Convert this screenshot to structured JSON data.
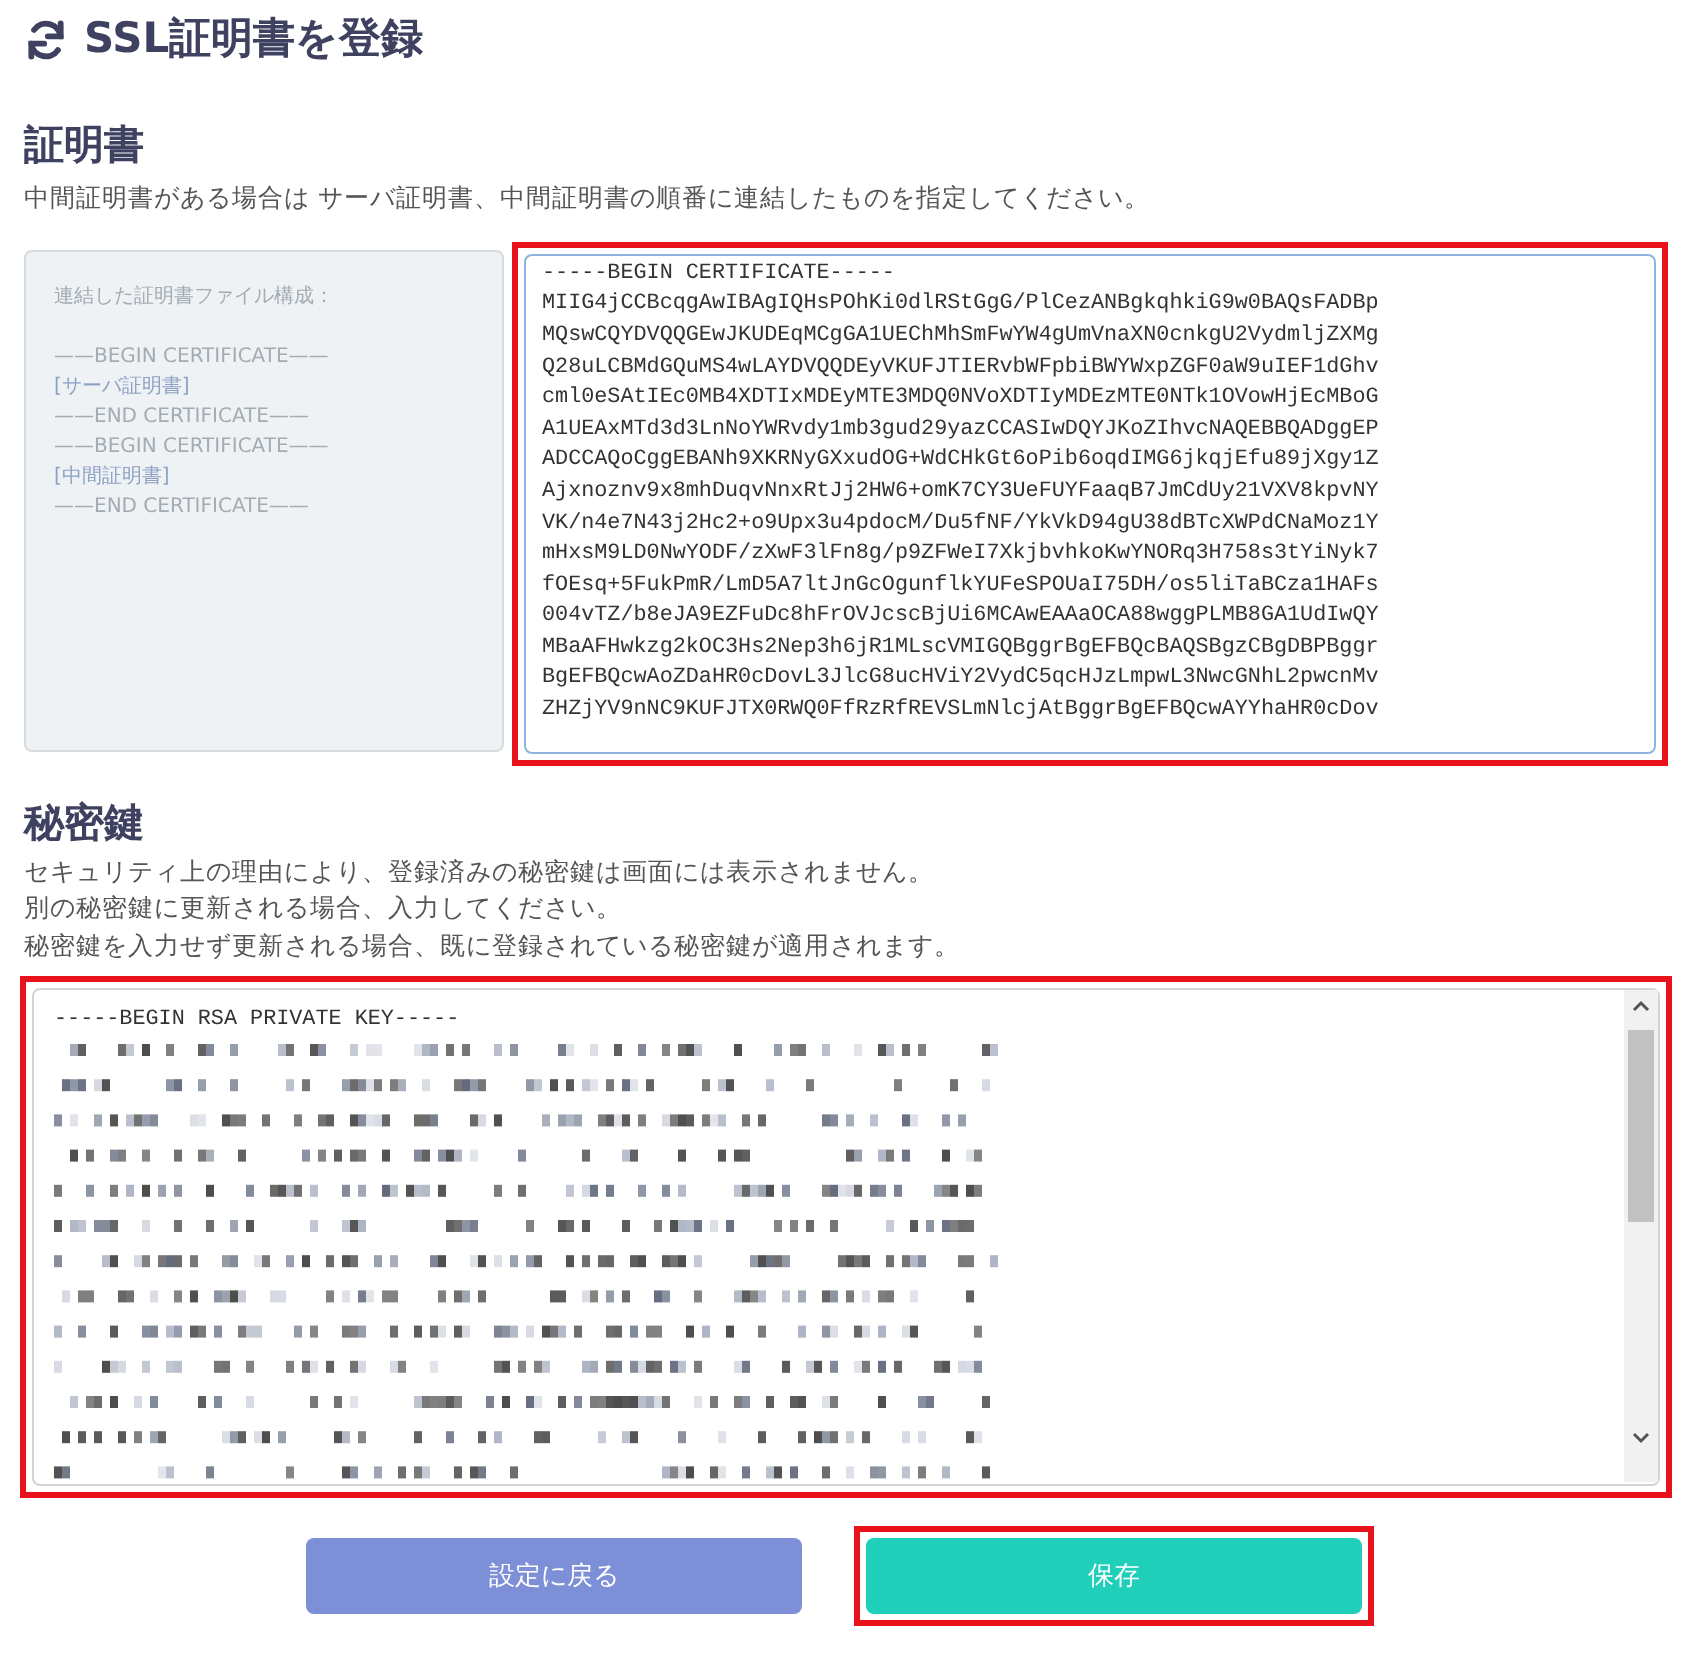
{
  "title": "SSL証明書を登録",
  "certificate": {
    "heading": "証明書",
    "description": "中間証明書がある場合は サーバ証明書、中間証明書の順番に連結したものを指定してください。",
    "format_hint": {
      "caption": "連結した証明書ファイル構成：",
      "lines": [
        {
          "text": "——BEGIN CERTIFICATE——",
          "kind": "boundary"
        },
        {
          "text": "[サーバ証明書]",
          "kind": "slot"
        },
        {
          "text": "——END CERTIFICATE——",
          "kind": "boundary"
        },
        {
          "text": "——BEGIN CERTIFICATE——",
          "kind": "boundary"
        },
        {
          "text": "[中間証明書]",
          "kind": "slot"
        },
        {
          "text": "——END CERTIFICATE——",
          "kind": "boundary"
        }
      ]
    },
    "value": "-----BEGIN CERTIFICATE-----\nMIIG4jCCBcqgAwIBAgIQHsPOhKi0dlRStGgG/PlCezANBgkqhkiG9w0BAQsFADBp\nMQswCQYDVQQGEwJKUDEqMCgGA1UEChMhSmFwYW4gUmVnaXN0cnkgU2VydmljZXMg\nQ28uLCBMdGQuMS4wLAYDVQQDEyVKUFJTIERvbWFpbiBWYWxpZGF0aW9uIEF1dGhv\ncml0eSAtIEc0MB4XDTIxMDEyMTE3MDQ0NVoXDTIyMDEzMTE0NTk1OVowHjEcMBoG\nA1UEAxMTd3d3LnNoYWRvdy1mb3gud29yazCCASIwDQYJKoZIhvcNAQEBBQADggEP\nADCCAQoCggEBANh9XKRNyGXxudOG+WdCHkGt6oPib6oqdIMG6jkqjEfu89jXgy1Z\nAjxnoznv9x8mhDuqvNnxRtJj2HW6+omK7CY3UeFUYFaaqB7JmCdUy21VXV8kpvNY\nVK/n4e7N43j2Hc2+o9Upx3u4pdocM/Du5fNF/YkVkD94gU38dBTcXWPdCNaMoz1Y\nmHxsM9LD0NwYODF/zXwF3lFn8g/p9ZFWeI7XkjbvhkoKwYNORq3H758s3tYiNyk7\nfOEsq+5FukPmR/LmD5A7ltJnGcOgunflkYUFeSPOUaI75DH/os5liTaBCza1HAFs\n004vTZ/b8eJA9EZFuDc8hFrOVJcscBjUi6MCAwEAAaOCA88wggPLMB8GA1UdIwQY\nMBaAFHwkzg2kOC3Hs2Nep3h6jR1MLscVMIGQBggrBgEFBQcBAQSBgzCBgDBPBggr\nBgEFBQcwAoZDaHR0cDovL3JlcG8ucHViY2VydC5qcHJzLmpwL3NwcGNhL2pwcnMv\nZHZjYV9nNC9KUFJTX0RWQ0FfRzRfREVSLmNlcjAtBggrBgEFBQcwAYYhaHR0cDov",
    "highlighted": true
  },
  "private_key": {
    "heading": "秘密鍵",
    "notes": [
      "セキュリティ上の理由により、登録済みの秘密鍵は画面には表示されません。",
      "別の秘密鍵に更新される場合、入力してください。",
      "秘密鍵を入力せず更新される場合、既に登録されている秘密鍵が適用されます。"
    ],
    "value": "-----BEGIN RSA PRIVATE KEY-----",
    "highlighted": true
  },
  "buttons": [
    {
      "label": "設定に戻る",
      "kind": "secondary",
      "highlighted": false
    },
    {
      "label": "保存",
      "kind": "primary",
      "highlighted": true
    }
  ]
}
